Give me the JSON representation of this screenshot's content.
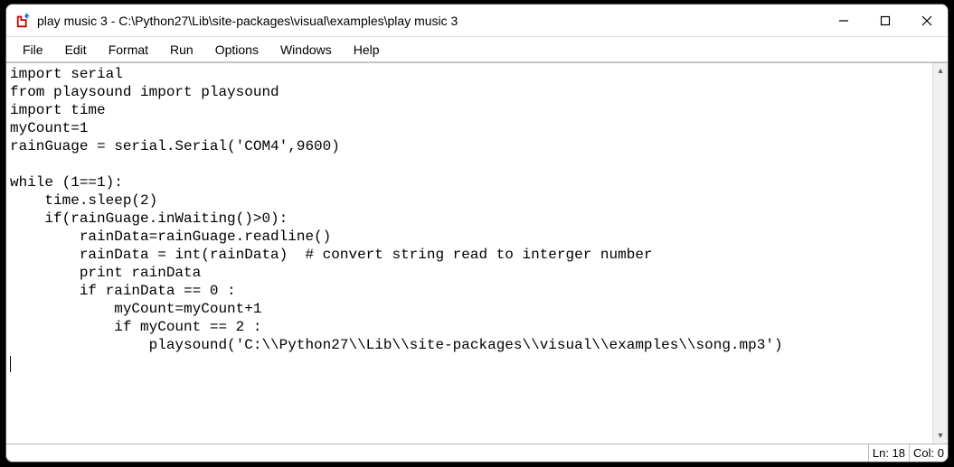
{
  "window": {
    "title": "play music 3 - C:\\Python27\\Lib\\site-packages\\visual\\examples\\play music 3"
  },
  "menu": {
    "file": "File",
    "edit": "Edit",
    "format": "Format",
    "run": "Run",
    "options": "Options",
    "windows": "Windows",
    "help": "Help"
  },
  "code": "import serial\nfrom playsound import playsound\nimport time\nmyCount=1\nrainGuage = serial.Serial('COM4',9600)\n\nwhile (1==1):\n    time.sleep(2)\n    if(rainGuage.inWaiting()>0):\n        rainData=rainGuage.readline()\n        rainData = int(rainData)  # convert string read to interger number\n        print rainData\n        if rainData == 0 :\n            myCount=myCount+1\n            if myCount == 2 :\n                playsound('C:\\\\Python27\\\\Lib\\\\site-packages\\\\visual\\\\examples\\\\song.mp3')\n",
  "status": {
    "line_label": "Ln: 18",
    "col_label": "Col: 0"
  },
  "scroll": {
    "up": "▴",
    "down": "▾"
  }
}
